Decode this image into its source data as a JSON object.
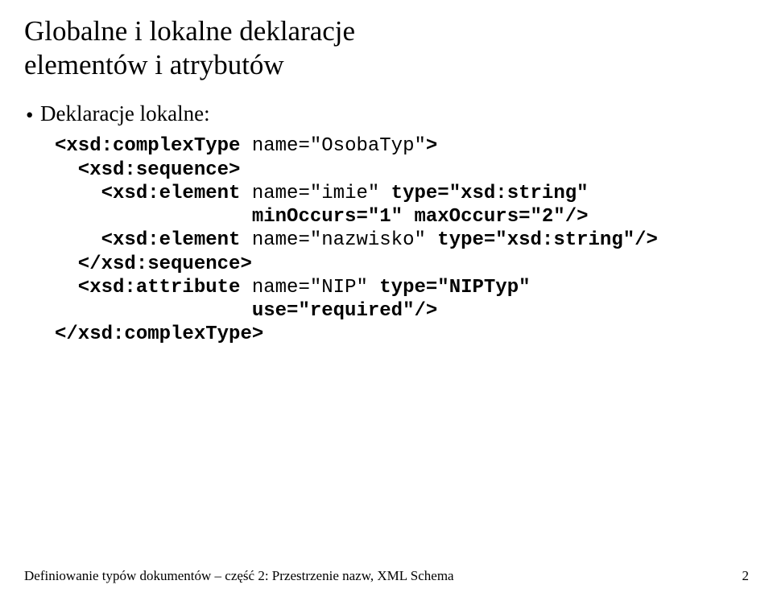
{
  "title_line1": "Globalne i lokalne deklaracje",
  "title_line2": "elementów i atrybutów",
  "bullet_label": "Deklaracje lokalne:",
  "code": {
    "l1a": "<xsd:complexType ",
    "l1b": "name=\"OsobaTyp\"",
    "l1c": ">",
    "l2": "  <xsd:sequence>",
    "l3a": "    <xsd:element ",
    "l3b": "name=\"imie\"",
    "l3c": " type=\"xsd:string\"",
    "l4": "                 minOccurs=\"1\" maxOccurs=\"2\"/>",
    "l5a": "    <xsd:element ",
    "l5b": "name=\"nazwisko\"",
    "l5c": " type=\"xsd:string\"/>",
    "l6": "  </xsd:sequence>",
    "l7a": "  <xsd:attribute ",
    "l7b": "name=\"NIP\"",
    "l7c": " type=\"NIPTyp\"",
    "l8": "                 use=\"required\"/>",
    "l9": "</xsd:complexType>"
  },
  "footer_text": "Definiowanie typów dokumentów – część 2: Przestrzenie nazw, XML Schema",
  "page_number": "2"
}
